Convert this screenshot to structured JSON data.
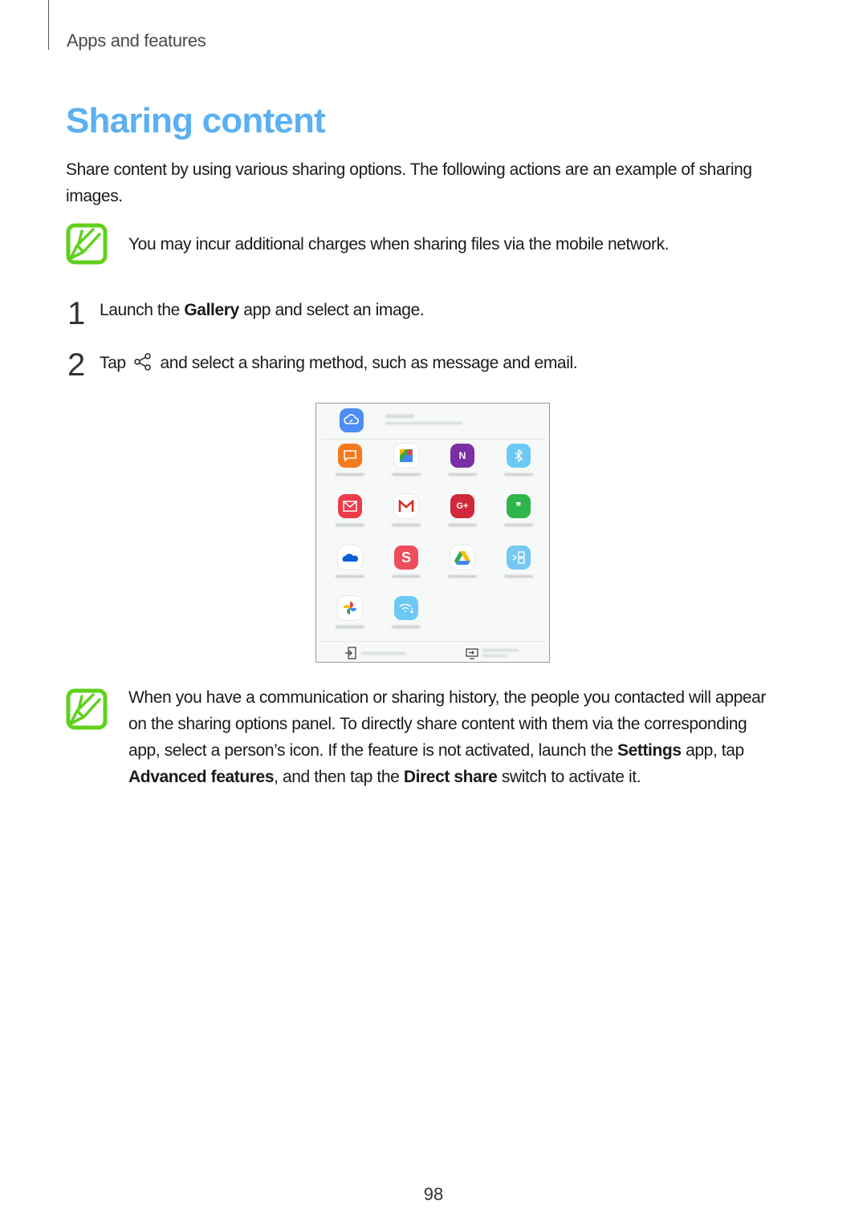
{
  "header": {
    "section": "Apps and features"
  },
  "title": "Sharing content",
  "intro": "Share content by using various sharing options. The following actions are an example of sharing images.",
  "notes": [
    {
      "icon": "note-pencil-icon",
      "text": "You may incur additional charges when sharing files via the mobile network."
    },
    {
      "icon": "note-pencil-icon",
      "parts": {
        "t1": "When you have a communication or sharing history, the people you contacted will appear on the sharing options panel. To directly share content with them via the corresponding app, select a person’s icon. If the feature is not activated, launch the ",
        "b1": "Settings",
        "t2": " app, tap ",
        "b2": "Advanced features",
        "t3": ", and then tap the ",
        "b3": "Direct share",
        "t4": " switch to activate it."
      }
    }
  ],
  "steps": [
    {
      "num": "1",
      "pre": "Launch the ",
      "bold": "Gallery",
      "post": " app and select an image."
    },
    {
      "num": "2",
      "pre": "Tap ",
      "icon": "share-icon",
      "post": " and select a sharing method, such as message and email."
    }
  ],
  "screenshot": {
    "top_icon": "cloud-link-sharing-icon",
    "apps": [
      {
        "icon": "messages-icon",
        "color": "#f47a1f"
      },
      {
        "icon": "google-maps-icon",
        "color": "#ffffff"
      },
      {
        "icon": "onenote-icon",
        "color": "#7b2fa5"
      },
      {
        "icon": "bluetooth-icon",
        "color": "#6cc9f5"
      },
      {
        "icon": "email-icon",
        "color": "#ef3b4a"
      },
      {
        "icon": "gmail-icon",
        "color": "#ffffff"
      },
      {
        "icon": "google-plus-icon",
        "color": "#d0283b"
      },
      {
        "icon": "hangouts-icon",
        "color": "#2eb64c"
      },
      {
        "icon": "onedrive-icon",
        "color": "#ffffff"
      },
      {
        "icon": "s-note-icon",
        "color": "#ef4d5b"
      },
      {
        "icon": "google-drive-icon",
        "color": "#ffffff"
      },
      {
        "icon": "scrapbook-icon",
        "color": "#74c8f2"
      },
      {
        "icon": "google-photos-icon",
        "color": "#ffffff"
      },
      {
        "icon": "wifi-direct-icon",
        "color": "#6cc9f5"
      }
    ],
    "bottom_actions": [
      {
        "icon": "transfer-files-icon"
      },
      {
        "icon": "screen-mirroring-icon"
      }
    ]
  },
  "page_number": "98"
}
